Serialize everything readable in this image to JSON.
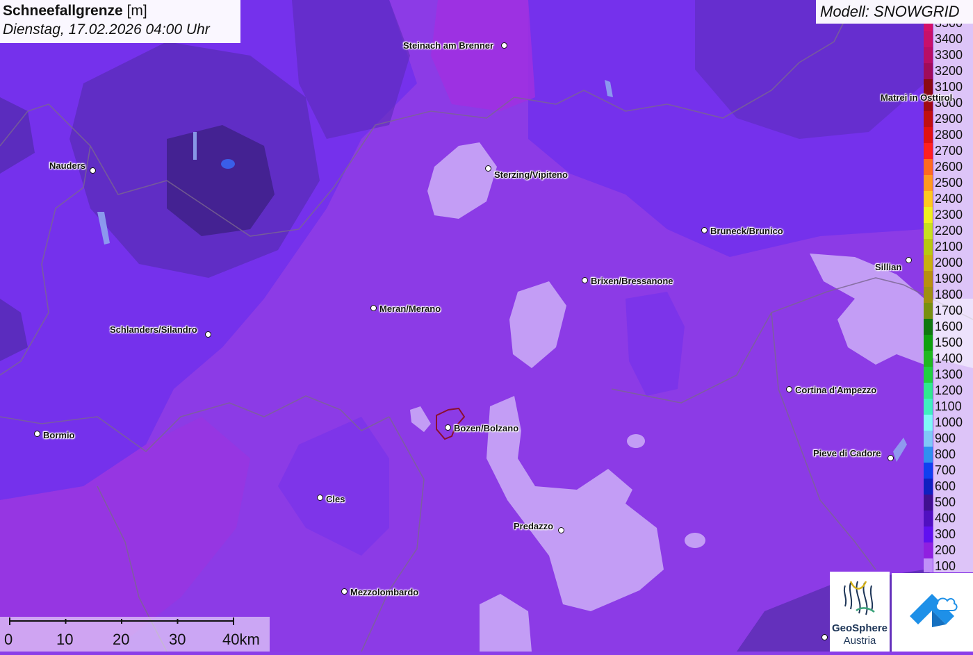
{
  "title": {
    "main": "Schneefallgrenze",
    "unit": "[m]",
    "datetime": "Dienstag, 17.02.2026 04:00 Uhr"
  },
  "model": "Modell: SNOWGRID",
  "legend": [
    {
      "value": "3500",
      "color": "#d4106a"
    },
    {
      "value": "3400",
      "color": "#c8106a"
    },
    {
      "value": "3300",
      "color": "#b80e66"
    },
    {
      "value": "3200",
      "color": "#a00c5a"
    },
    {
      "value": "3100",
      "color": "#8a0a14"
    },
    {
      "value": "3000",
      "color": "#a00a12"
    },
    {
      "value": "2900",
      "color": "#c01010"
    },
    {
      "value": "2800",
      "color": "#e01212"
    },
    {
      "value": "2700",
      "color": "#ff2020"
    },
    {
      "value": "2600",
      "color": "#ff6a20"
    },
    {
      "value": "2500",
      "color": "#ff9a20"
    },
    {
      "value": "2400",
      "color": "#ffc820"
    },
    {
      "value": "2300",
      "color": "#f0f020"
    },
    {
      "value": "2200",
      "color": "#c8e020"
    },
    {
      "value": "2100",
      "color": "#b8c810"
    },
    {
      "value": "2000",
      "color": "#c8b010"
    },
    {
      "value": "1900",
      "color": "#b89010"
    },
    {
      "value": "1800",
      "color": "#a09010"
    },
    {
      "value": "1700",
      "color": "#789010"
    },
    {
      "value": "1600",
      "color": "#107810"
    },
    {
      "value": "1500",
      "color": "#10a010"
    },
    {
      "value": "1400",
      "color": "#20b820"
    },
    {
      "value": "1300",
      "color": "#20d040"
    },
    {
      "value": "1200",
      "color": "#30e890"
    },
    {
      "value": "1100",
      "color": "#40f0c0"
    },
    {
      "value": "1000",
      "color": "#80f8f8"
    },
    {
      "value": "900",
      "color": "#80c8f8"
    },
    {
      "value": "800",
      "color": "#3090f0"
    },
    {
      "value": "700",
      "color": "#1040f0"
    },
    {
      "value": "600",
      "color": "#1020c0"
    },
    {
      "value": "500",
      "color": "#401090"
    },
    {
      "value": "400",
      "color": "#5010c0"
    },
    {
      "value": "300",
      "color": "#6010f0"
    },
    {
      "value": "200",
      "color": "#9020e0"
    },
    {
      "value": "100",
      "color": "#c090f8"
    }
  ],
  "places": [
    {
      "name": "Steinach am Brenner",
      "id": "steinach"
    },
    {
      "name": "Nauders",
      "id": "nauders"
    },
    {
      "name": "Sterzing/Vipiteno",
      "id": "sterzing"
    },
    {
      "name": "Matrei in Osttirol",
      "id": "matrei"
    },
    {
      "name": "Bruneck/Brunico",
      "id": "bruneck"
    },
    {
      "name": "Sillian",
      "id": "sillian"
    },
    {
      "name": "Brixen/Bressanone",
      "id": "brixen"
    },
    {
      "name": "Meran/Merano",
      "id": "meran"
    },
    {
      "name": "Schlanders/Silandro",
      "id": "schlanders"
    },
    {
      "name": "Cortina d'Ampezzo",
      "id": "cortina"
    },
    {
      "name": "Bormio",
      "id": "bormio"
    },
    {
      "name": "Bozen/Bolzano",
      "id": "bozen"
    },
    {
      "name": "Pieve di Cadore",
      "id": "pieve"
    },
    {
      "name": "Cles",
      "id": "cles"
    },
    {
      "name": "Predazzo",
      "id": "predazzo"
    },
    {
      "name": "Mezzolombardo",
      "id": "mezzolombardo"
    }
  ],
  "scale": {
    "labels": [
      "0",
      "10",
      "20",
      "30",
      "40km"
    ]
  },
  "logos": {
    "geo_line1": "GeoSphere",
    "geo_line2": "Austria"
  }
}
